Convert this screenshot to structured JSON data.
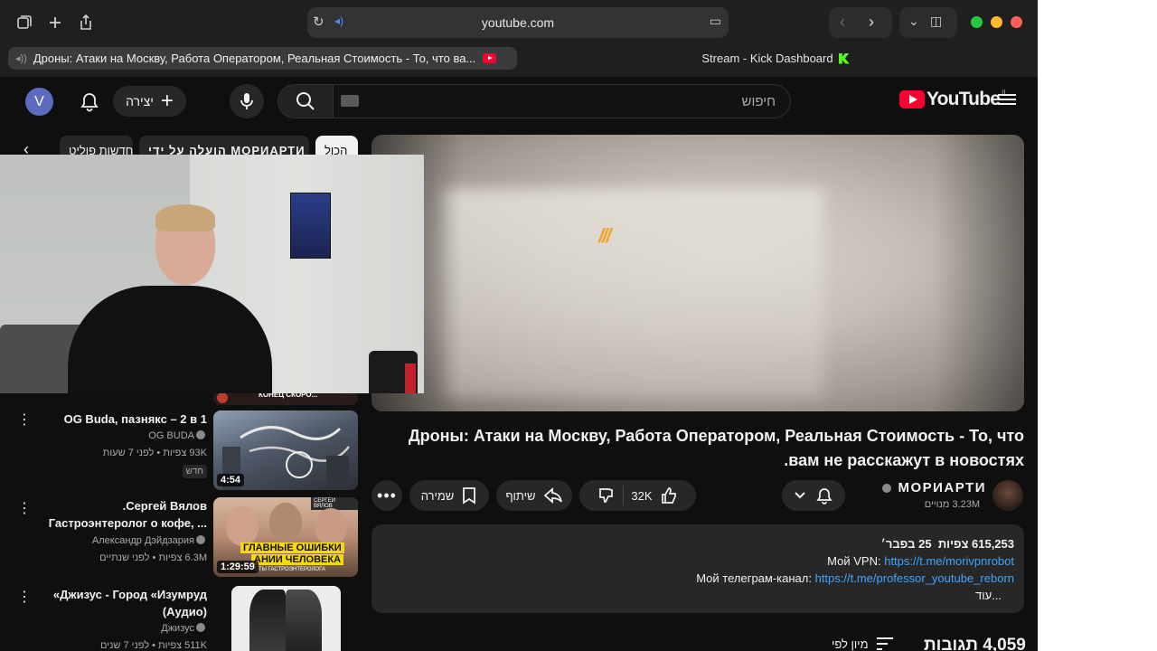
{
  "browser": {
    "url": "youtube.com",
    "tabs": [
      {
        "label": "Дроны: Атаки на Москву, Работа Оператором, Реальная Стоимость - То, что ва..."
      },
      {
        "label": "Stream - Kick Dashboard"
      }
    ],
    "colors": {
      "close": "#ff5f57",
      "minimize": "#febc2e",
      "zoom": "#28c840"
    }
  },
  "header": {
    "avatar_letter": "V",
    "create_label": "יצירה",
    "search_placeholder": "חיפוש",
    "logo_text": "YouTube",
    "logo_country": "IL"
  },
  "chips": [
    {
      "label": "הכול"
    },
    {
      "label": "הועלה על ידי МОРИАРТИ"
    },
    {
      "label": "חדשות פוליט"
    }
  ],
  "video": {
    "title": "Дроны: Атаки на Москву, Работа Оператором, Реальная Стоимость - То, что вам не расскажут в новостях.",
    "watermark": "///",
    "channel": "МОРИАРТИ",
    "subscribers": "3.23M מנויים",
    "likes": "32K",
    "share_label": "שיתוף",
    "save_label": "שמירה",
    "description": {
      "views": "615,253 צפיות",
      "date": "25 בפבר׳",
      "vpn_prefix": "Мой VPN: ",
      "vpn_link": "https://t.me/morivpnrobot",
      "tg_prefix": "Мой телеграм-канал: ",
      "tg_link": "https://t.me/professor_youtube_reborn",
      "more": "...עוד"
    },
    "comments_count": "4,059 תגובות",
    "sort_label": "מיון לפי"
  },
  "recommendations": [
    {
      "partial_thumb_text": "КОНЕЦ СКОРО...",
      "title": "OG Buda, пазнякс – 2 в 1",
      "channel": "OG BUDA",
      "meta": "93K צפיות • לפני 7 שעות",
      "badge": "חדש",
      "duration": "4:54"
    },
    {
      "title_line1": "Сергей Вялов.",
      "title_line2": "Гастроэнтеролог о кофе, ...",
      "channel": "Александр Дэйдзария",
      "meta": "6.3M צפיות • לפני שנתיים",
      "duration": "1:29:59",
      "thumb_text": "ГЛАВНЫЕ ОШИБКИ",
      "thumb_text2": "АНИИ ЧЕЛОВЕКА",
      "thumb_sub": "ЕТЫ ГАСТРОЭНТЕРОЛОГА",
      "thumb_tag": "СЕРГЕЙ ВЯЛОВ"
    },
    {
      "title_line1": "Джизус - Город «Изумруд»",
      "title_line2": "(Аудио)",
      "channel": "Джизус",
      "meta": "511K צפיות • לפני 7 שנים"
    }
  ]
}
